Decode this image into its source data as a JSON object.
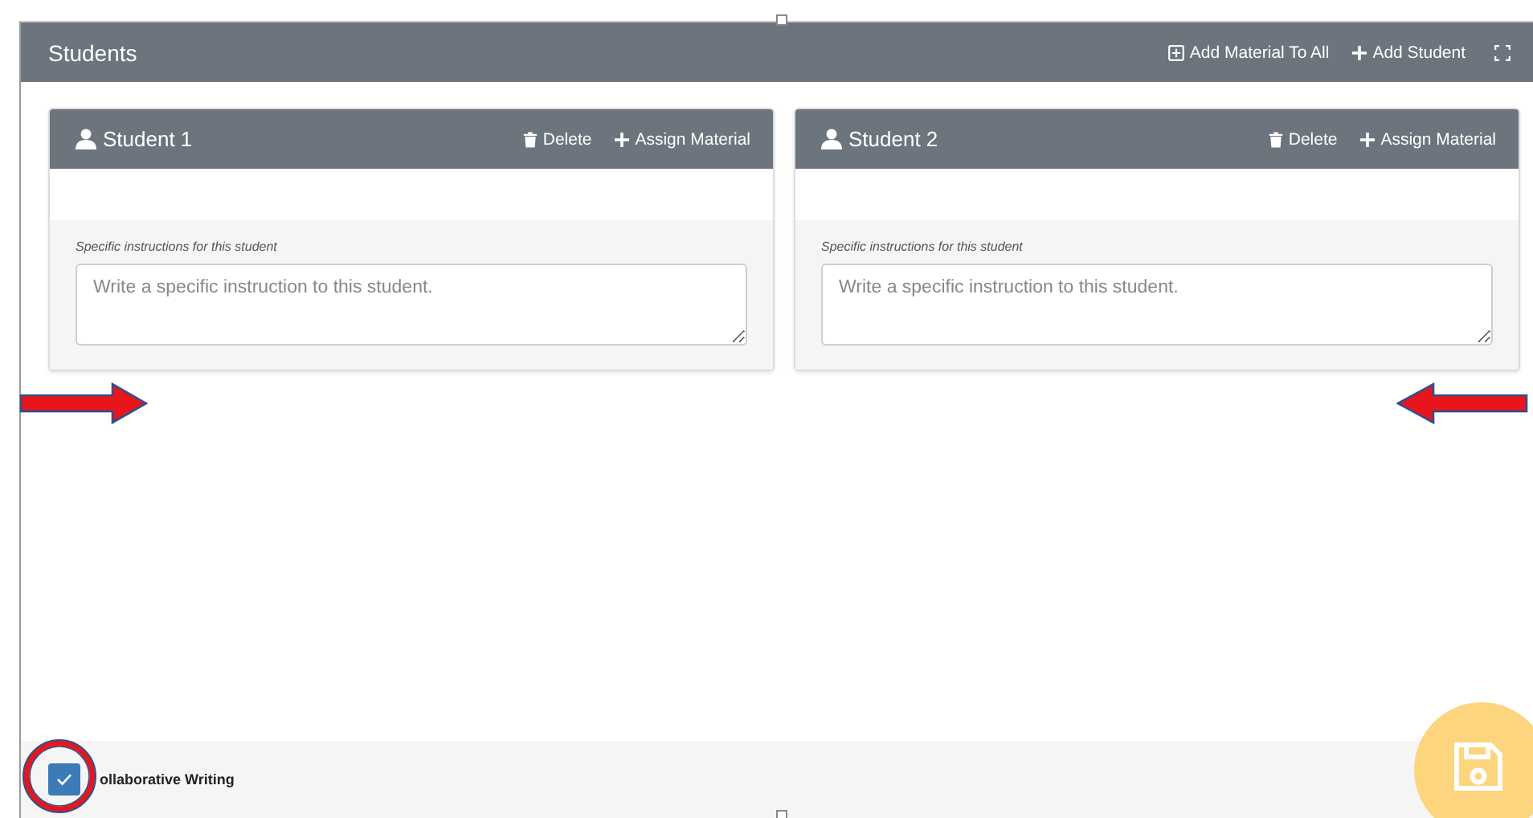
{
  "panel": {
    "title": "Students",
    "actions": [
      {
        "kind": "add-all",
        "label": "Add Material To All"
      },
      {
        "kind": "add",
        "label": "Add Student"
      }
    ]
  },
  "students": [
    {
      "name": "Student 1",
      "actions": [
        {
          "kind": "delete",
          "label": "Delete"
        },
        {
          "kind": "add",
          "label": "Assign Material"
        }
      ],
      "instructions_label": "Specific instructions for this student",
      "instructions_field": {
        "placeholder": "Write a specific instruction to this student."
      }
    },
    {
      "name": "Student 2",
      "actions": [
        {
          "kind": "delete",
          "label": "Delete"
        },
        {
          "kind": "add",
          "label": "Assign Material"
        }
      ],
      "instructions_label": "Specific instructions for this student",
      "instructions_field": {
        "placeholder": "Write a specific instruction to this student."
      }
    }
  ],
  "footer": {
    "checkbox": {
      "label": "ollaborative Writing",
      "checked": true
    }
  }
}
